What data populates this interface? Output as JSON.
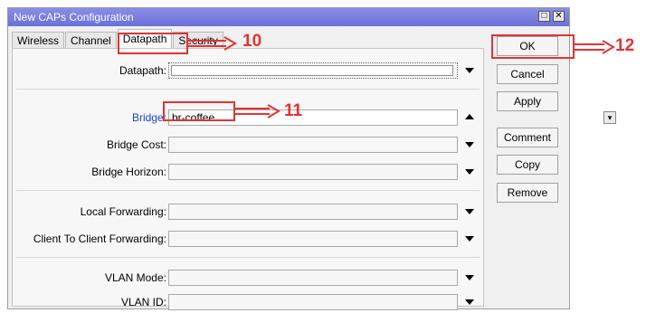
{
  "window": {
    "title": "New CAPs Configuration"
  },
  "tabs": [
    {
      "label": "Wireless"
    },
    {
      "label": "Channel"
    },
    {
      "label": "Datapath",
      "active": true
    },
    {
      "label": "Security"
    }
  ],
  "form": {
    "datapath": {
      "label": "Datapath:",
      "value": ""
    },
    "bridge": {
      "label": "Bridge:",
      "value": "br-coffee"
    },
    "bridge_cost": {
      "label": "Bridge Cost:",
      "value": ""
    },
    "bridge_horizon": {
      "label": "Bridge Horizon:",
      "value": ""
    },
    "local_forwarding": {
      "label": "Local Forwarding:",
      "value": ""
    },
    "client_to_client": {
      "label": "Client To Client Forwarding:",
      "value": ""
    },
    "vlan_mode": {
      "label": "VLAN Mode:",
      "value": ""
    },
    "vlan_id": {
      "label": "VLAN ID:",
      "value": ""
    }
  },
  "buttons": {
    "ok": "OK",
    "cancel": "Cancel",
    "apply": "Apply",
    "comment": "Comment",
    "copy": "Copy",
    "remove": "Remove"
  },
  "annotations": {
    "step10": "10",
    "step11": "11",
    "step12": "12"
  },
  "colors": {
    "annotation": "#e23333",
    "titlebar": "#7a7fe0",
    "bridge_label": "#1a3fd6"
  }
}
